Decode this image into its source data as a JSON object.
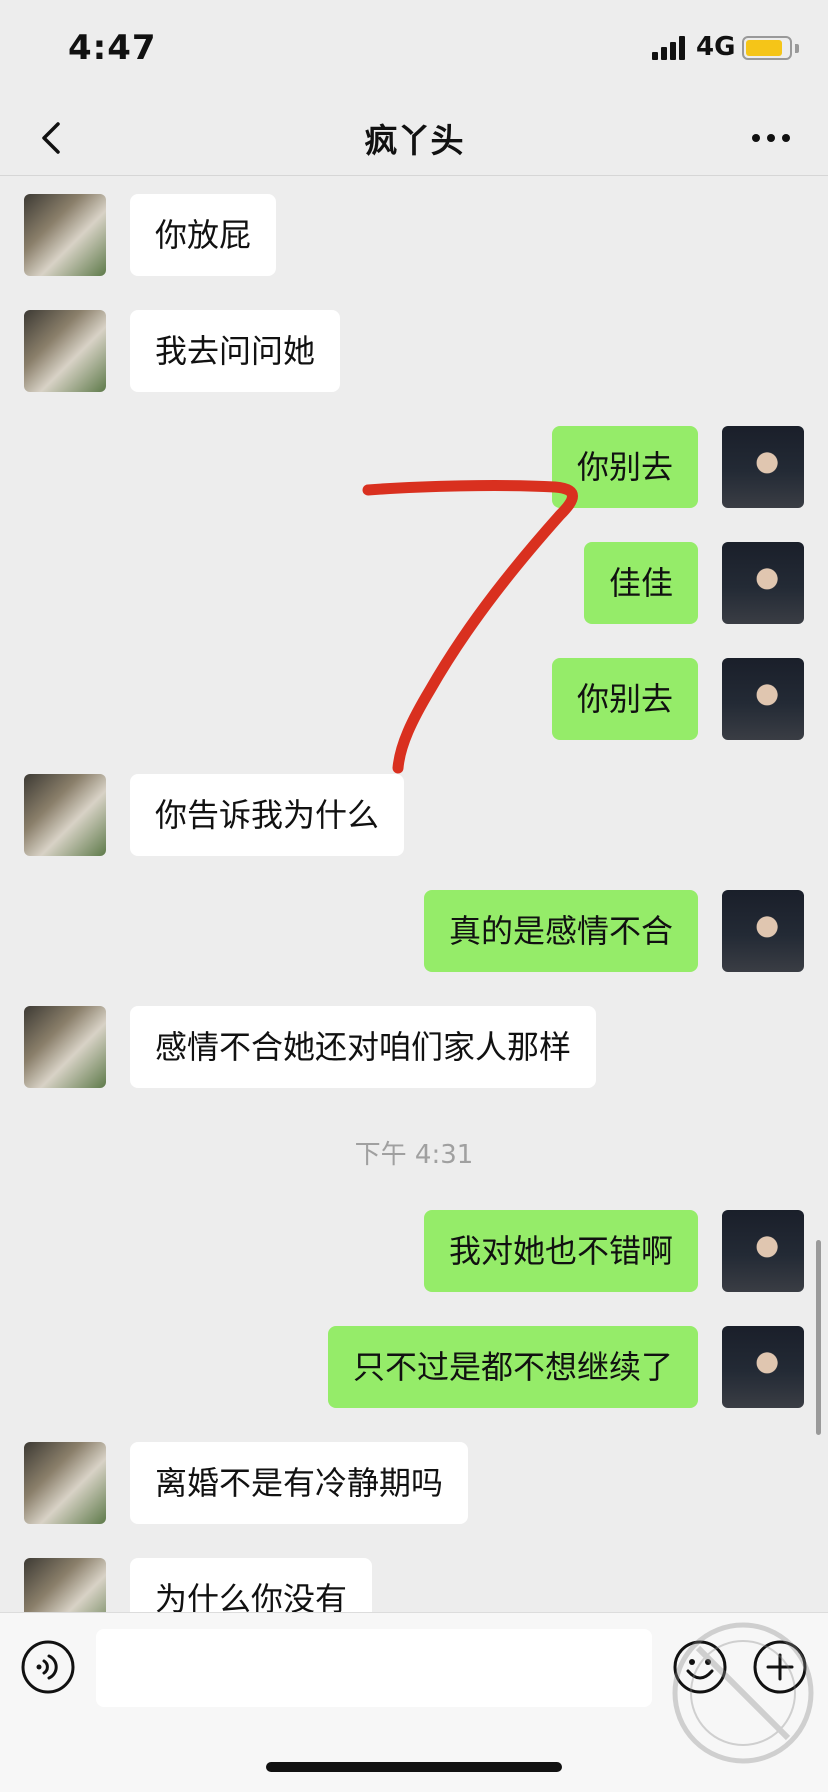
{
  "status_bar": {
    "time": "4:47",
    "network": "4G"
  },
  "header": {
    "title": "疯丫头"
  },
  "messages": [
    {
      "side": "left",
      "text": "你放屁"
    },
    {
      "side": "left",
      "text": "我去问问她"
    },
    {
      "side": "right",
      "text": "你别去"
    },
    {
      "side": "right",
      "text": "佳佳"
    },
    {
      "side": "right",
      "text": "你别去"
    },
    {
      "side": "left",
      "text": "你告诉我为什么"
    },
    {
      "side": "right",
      "text": "真的是感情不合"
    },
    {
      "side": "left",
      "text": "感情不合她还对咱们家人那样"
    },
    {
      "side": "right",
      "text": "我对她也不错啊"
    },
    {
      "side": "right",
      "text": "只不过是都不想继续了"
    },
    {
      "side": "left",
      "text": "离婚不是有冷静期吗"
    },
    {
      "side": "left",
      "text": "为什么你没有"
    }
  ],
  "time_separator": "下午 4:31",
  "input": {
    "value": "",
    "placeholder": ""
  },
  "colors": {
    "background": "#ededed",
    "sent_bubble": "#95ec69",
    "received_bubble": "#ffffff",
    "annotation": "#d9301f"
  },
  "icons": [
    "back-icon",
    "more-icon",
    "voice-icon",
    "emoji-icon",
    "plus-icon"
  ]
}
